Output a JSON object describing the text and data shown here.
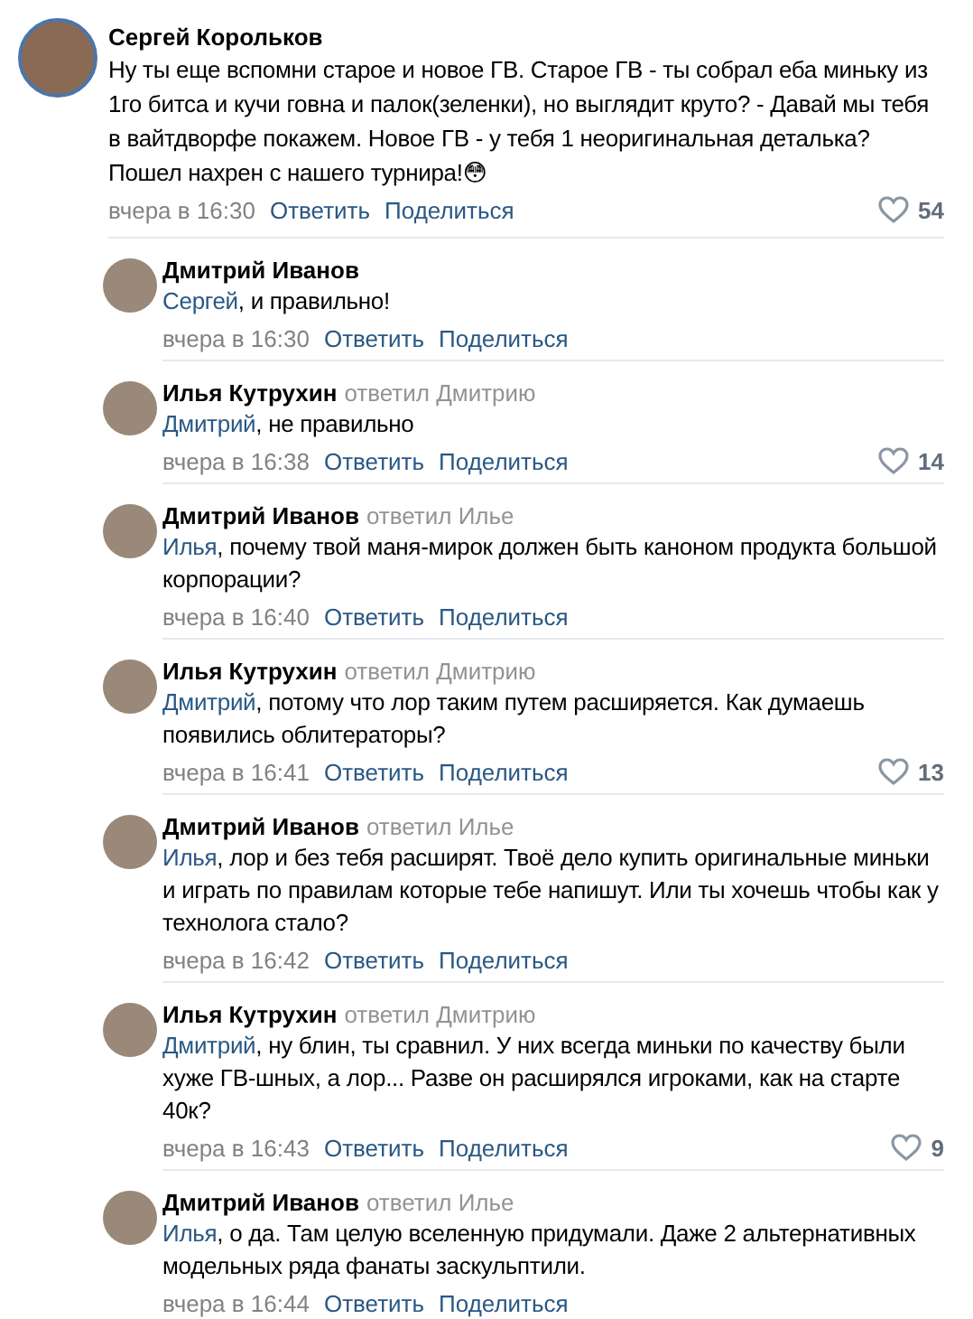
{
  "comment": {
    "author": "Сергей Корольков",
    "text": "Ну ты еще вспомни старое и новое ГВ. Старое ГВ - ты собрал еба миньку из 1го битса и кучи говна и палок(зеленки), но выглядит круто? - Давай мы тебя в вайтдворфе покажем. Новое ГВ - у тебя 1 неоригинальная деталька? Пошел нахрен с нашего турнира!😳",
    "time": "вчера в 16:30",
    "reply_label": "Ответить",
    "share_label": "Поделиться",
    "likes": "54"
  },
  "replies": [
    {
      "author": "Дмитрий Иванов",
      "mention": "Сергей",
      "text": ", и правильно!",
      "time": "вчера в 16:30",
      "reply_label": "Ответить",
      "share_label": "Поделиться"
    },
    {
      "author": "Илья Кутрухин",
      "replied_to": "ответил Дмитрию",
      "mention": "Дмитрий",
      "text": ", не правильно",
      "time": "вчера в 16:38",
      "reply_label": "Ответить",
      "share_label": "Поделиться",
      "likes": "14"
    },
    {
      "author": "Дмитрий Иванов",
      "replied_to": "ответил Илье",
      "mention": "Илья",
      "text": ", почему твой маня-мирок должен быть каноном продукта большой корпорации?",
      "time": "вчера в 16:40",
      "reply_label": "Ответить",
      "share_label": "Поделиться"
    },
    {
      "author": "Илья Кутрухин",
      "replied_to": "ответил Дмитрию",
      "mention": "Дмитрий",
      "text": ", потому что лор таким путем расширяется. Как думаешь появились облитераторы?",
      "time": "вчера в 16:41",
      "reply_label": "Ответить",
      "share_label": "Поделиться",
      "likes": "13"
    },
    {
      "author": "Дмитрий Иванов",
      "replied_to": "ответил Илье",
      "mention": "Илья",
      "text": ", лор и без тебя расширят. Твоё дело купить оригинальные миньки и играть по правилам которые тебе напишут. Или ты хочешь чтобы как у технолога стало?",
      "time": "вчера в 16:42",
      "reply_label": "Ответить",
      "share_label": "Поделиться"
    },
    {
      "author": "Илья Кутрухин",
      "replied_to": "ответил Дмитрию",
      "mention": "Дмитрий",
      "text": ", ну блин, ты сравнил. У них всегда миньки по качеству были хуже ГВ-шных, а лор... Разве он расширялся игроками, как на старте 40к?",
      "time": "вчера в 16:43",
      "reply_label": "Ответить",
      "share_label": "Поделиться",
      "likes": "9"
    },
    {
      "author": "Дмитрий Иванов",
      "replied_to": "ответил Илье",
      "mention": "Илья",
      "text": ", о да. Там целую вселенную придумали. Даже 2 альтернативных модельных ряда фанаты заскульптили.",
      "time": "вчера в 16:44",
      "reply_label": "Ответить",
      "share_label": "Поделиться"
    }
  ]
}
